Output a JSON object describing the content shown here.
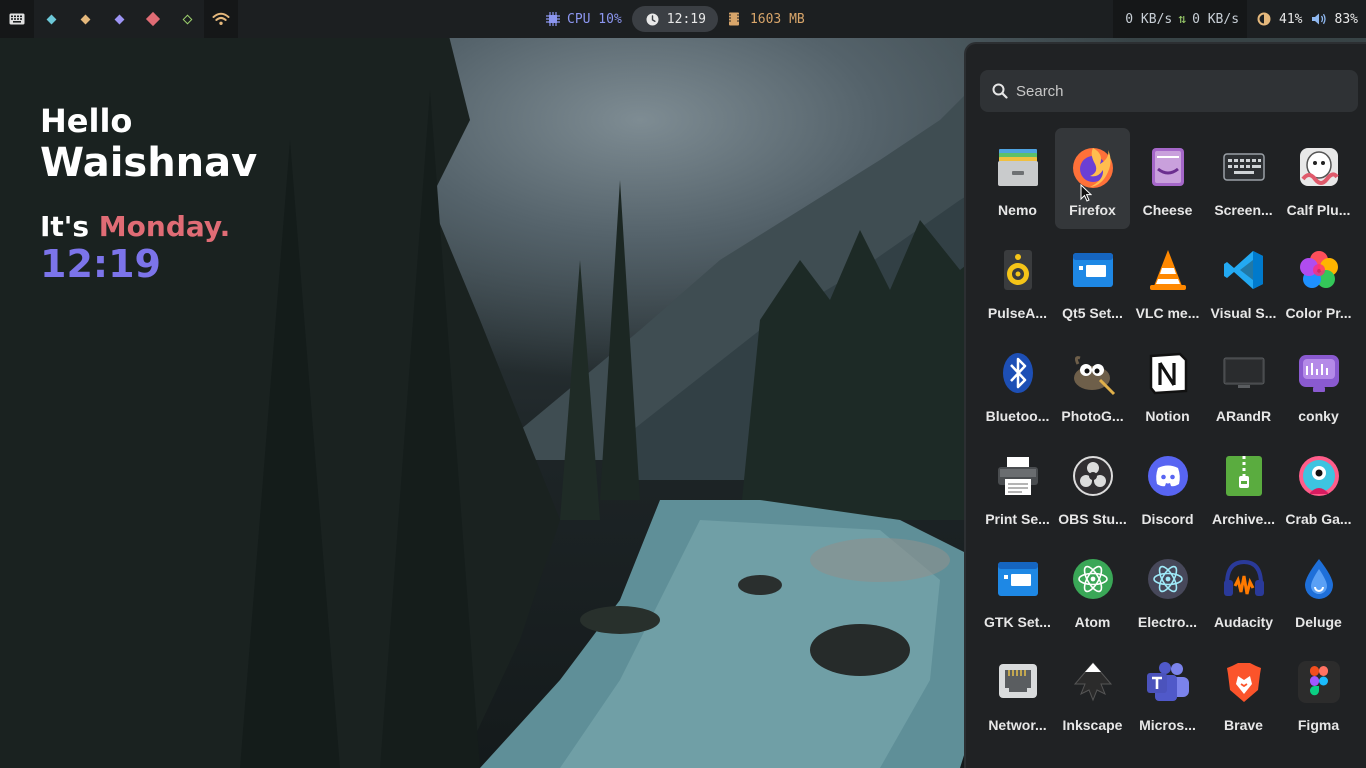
{
  "topbar": {
    "cpu": "CPU 10%",
    "time": "12:19",
    "memory": "1603 MB",
    "net_down": "0 KB/s",
    "net_up": "0 KB/s",
    "brightness": "41%",
    "volume": "83%",
    "workspace_colors": [
      "#6cc8d8",
      "#e5b87c",
      "#9d94f4",
      "#e06c75",
      "#9ccf6c"
    ]
  },
  "greeting": {
    "hello": "Hello",
    "name": "Waishnav",
    "its": "It's ",
    "day": "Monday.",
    "time": "12:19"
  },
  "launcher": {
    "search_placeholder": "Search",
    "apps": [
      {
        "label": "Nemo",
        "icon": "nemo-icon"
      },
      {
        "label": "Firefox",
        "icon": "firefox-icon"
      },
      {
        "label": "Cheese",
        "icon": "cheese-icon"
      },
      {
        "label": "Screen...",
        "icon": "screenkey-icon"
      },
      {
        "label": "Calf Plu...",
        "icon": "calf-plugins-icon"
      },
      {
        "label": "PulseA...",
        "icon": "pulseaudio-icon"
      },
      {
        "label": "Qt5 Set...",
        "icon": "qt5-settings-icon"
      },
      {
        "label": "VLC me...",
        "icon": "vlc-icon"
      },
      {
        "label": "Visual S...",
        "icon": "vscode-icon"
      },
      {
        "label": "Color Pr...",
        "icon": "color-picker-icon"
      },
      {
        "label": "Bluetoo...",
        "icon": "bluetooth-icon"
      },
      {
        "label": "PhotoG...",
        "icon": "gimp-icon"
      },
      {
        "label": "Notion",
        "icon": "notion-icon"
      },
      {
        "label": "ARandR",
        "icon": "arandr-icon"
      },
      {
        "label": "conky",
        "icon": "conky-icon"
      },
      {
        "label": "Print Se...",
        "icon": "printer-icon"
      },
      {
        "label": "OBS Stu...",
        "icon": "obs-icon"
      },
      {
        "label": "Discord",
        "icon": "discord-icon"
      },
      {
        "label": "Archive...",
        "icon": "archive-manager-icon"
      },
      {
        "label": "Crab Ga...",
        "icon": "crab-game-icon"
      },
      {
        "label": "GTK Set...",
        "icon": "gtk-settings-icon"
      },
      {
        "label": "Atom",
        "icon": "atom-icon"
      },
      {
        "label": "Electro...",
        "icon": "electron-icon"
      },
      {
        "label": "Audacity",
        "icon": "audacity-icon"
      },
      {
        "label": "Deluge",
        "icon": "deluge-icon"
      },
      {
        "label": "Networ...",
        "icon": "network-icon"
      },
      {
        "label": "Inkscape",
        "icon": "inkscape-icon"
      },
      {
        "label": "Micros...",
        "icon": "ms-teams-icon"
      },
      {
        "label": "Brave",
        "icon": "brave-icon"
      },
      {
        "label": "Figma",
        "icon": "figma-icon"
      }
    ]
  }
}
